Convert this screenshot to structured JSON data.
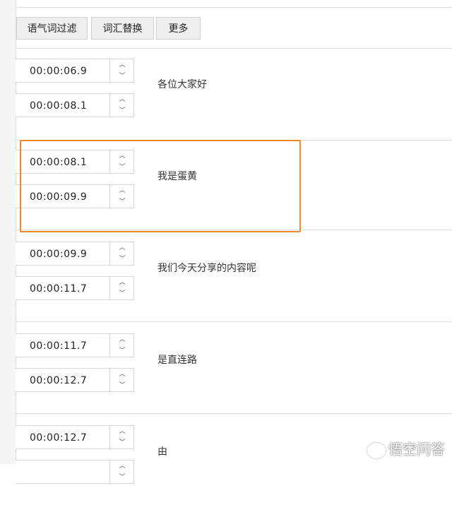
{
  "toolbar": {
    "buttons": [
      "语气词过滤",
      "词汇替换",
      "更多"
    ]
  },
  "rows": [
    {
      "start": "00:00:06.9",
      "end": "00:00:08.1",
      "text": "各位大家好"
    },
    {
      "start": "00:00:08.1",
      "end": "00:00:09.9",
      "text": "我是蛋黄"
    },
    {
      "start": "00:00:09.9",
      "end": "00:00:11.7",
      "text": "我们今天分享的内容呢"
    },
    {
      "start": "00:00:11.7",
      "end": "00:00:12.7",
      "text": "是直连路"
    },
    {
      "start": "00:00:12.7",
      "end": "",
      "text": "由"
    }
  ],
  "icons": {
    "up": "chevron-up-icon",
    "down": "chevron-down-icon"
  },
  "highlight_color": "#f0892e",
  "watermark": "悟空问答"
}
